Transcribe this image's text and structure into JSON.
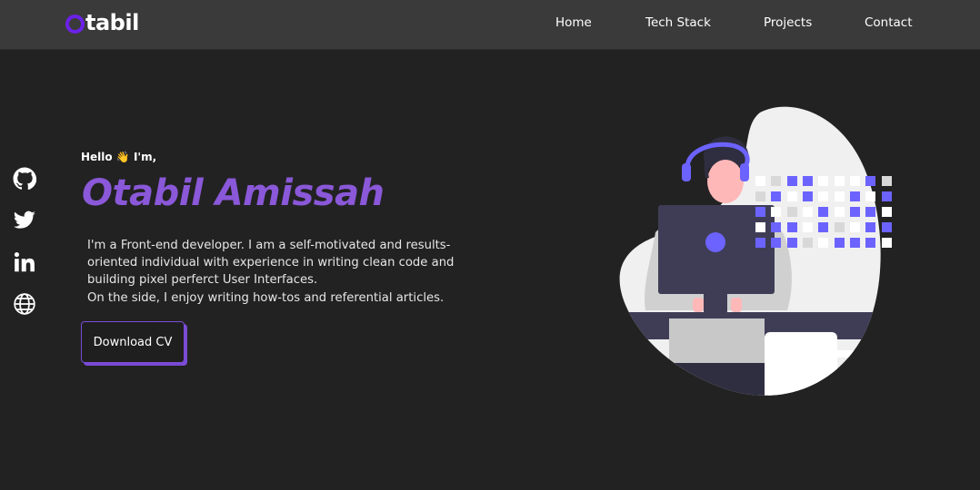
{
  "brand": {
    "logo_rest": "tabil",
    "accent": "#6b21e8"
  },
  "nav": {
    "items": [
      "Home",
      "Tech Stack",
      "Projects",
      "Contact"
    ]
  },
  "socials": [
    "github-icon",
    "twitter-icon",
    "linkedin-icon",
    "globe-icon"
  ],
  "hero": {
    "greeting": "Hello 👋 I'm,",
    "name": "Otabil Amissah",
    "bio_lines": [
      "I'm a Front-end developer. I am a self-motivated and results-oriented individual with experience in writing clean code and building pixel perferct User Interfaces.",
      "On the side, I enjoy writing how-tos and referential articles."
    ],
    "cta": "Download CV"
  },
  "colors": {
    "background": "#222222",
    "navbar": "#3a3a3a",
    "name": "#8a58d8",
    "button_border": "#7b4bd6"
  }
}
